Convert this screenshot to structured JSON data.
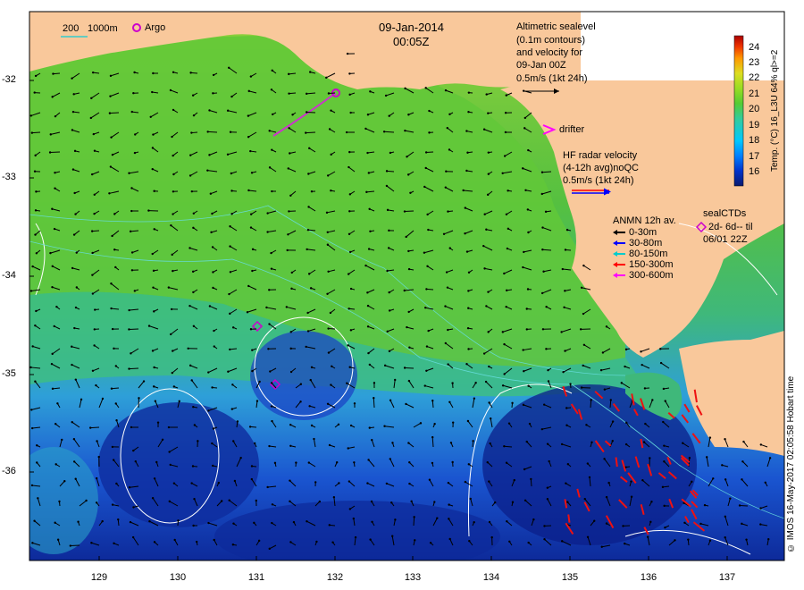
{
  "header": {
    "date": "09-Jan-2014",
    "time": "00:05Z"
  },
  "scale_bar": {
    "label_a": "200",
    "label_b": "1000m"
  },
  "argo": {
    "label": "Argo",
    "color": "#cc00cc"
  },
  "altimetry": {
    "lines": [
      "Altimetric sealevel",
      "(0.1m contours)",
      "and velocity for",
      "09-Jan 00Z",
      "0.5m/s (1kt 24h)"
    ]
  },
  "drifter": {
    "label": "drifter",
    "color": "#ff00ff"
  },
  "hf_radar": {
    "lines": [
      "HF radar velocity",
      "(4-12h avg)noQC",
      "0.5m/s (1kt 24h)"
    ]
  },
  "anmn": {
    "title": "ANMN 12h av.",
    "rows": [
      {
        "label": "0-30m",
        "color": "#000000"
      },
      {
        "label": "30-80m",
        "color": "#0000ff"
      },
      {
        "label": "80-150m",
        "color": "#00cccc"
      },
      {
        "label": "150-300m",
        "color": "#ff0000"
      },
      {
        "label": "300-600m",
        "color": "#ff00ff"
      }
    ]
  },
  "sealctds": {
    "lines": [
      "sealCTDs",
      "2d- 6d-- til",
      "06/01 22Z"
    ],
    "color": "#cc00cc"
  },
  "colorbar": {
    "ticks": [
      "24",
      "23",
      "22",
      "21",
      "20",
      "19",
      "18",
      "17",
      "16"
    ],
    "label": "Temp. (°C) 16_L3U 64% ql>=2",
    "colors": [
      "#0a1a6e",
      "#0033cc",
      "#0080ff",
      "#00c8ff",
      "#33cc99",
      "#55cc33",
      "#99dd22",
      "#dddd22",
      "#ff9900",
      "#ee3300",
      "#aa0000"
    ]
  },
  "axes": {
    "y_ticks": [
      "-32",
      "-33",
      "-34",
      "-35",
      "-36"
    ],
    "x_ticks": [
      "129",
      "130",
      "131",
      "132",
      "133",
      "134",
      "135",
      "136",
      "137"
    ]
  },
  "credit": "© IMOS 16-May-2017 02:05:58 Hobart time",
  "colors": {
    "land": "#f9c89b",
    "ocean_green": "#66cc33",
    "ocean_cyan": "#33aadd",
    "ocean_blue": "#1a3fc4",
    "ocean_deep": "#0b1f8a"
  }
}
